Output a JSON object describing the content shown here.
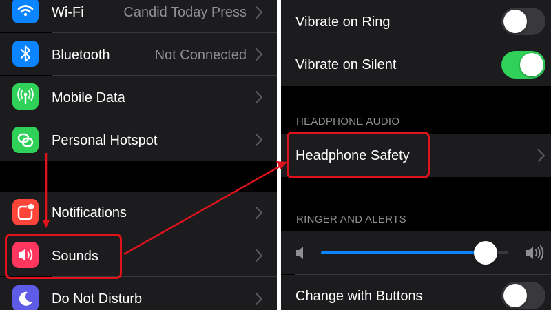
{
  "left_panel": {
    "rows": [
      {
        "label": "Wi-Fi",
        "value": "Candid Today Press",
        "icon": "wifi-icon",
        "icon_color": "#0a84ff"
      },
      {
        "label": "Bluetooth",
        "value": "Not Connected",
        "icon": "bluetooth-icon",
        "icon_color": "#0a84ff"
      },
      {
        "label": "Mobile Data",
        "value": "",
        "icon": "antenna-icon",
        "icon_color": "#30d158"
      },
      {
        "label": "Personal Hotspot",
        "value": "",
        "icon": "hotspot-icon",
        "icon_color": "#30d158"
      },
      {
        "label": "Notifications",
        "value": "",
        "icon": "notifications-icon",
        "icon_color": "#ff453a"
      },
      {
        "label": "Sounds",
        "value": "",
        "icon": "speaker-icon",
        "icon_color": "#ff375f"
      },
      {
        "label": "Do Not Disturb",
        "value": "",
        "icon": "moon-icon",
        "icon_color": "#5e5ce6"
      }
    ]
  },
  "right_panel": {
    "vibrate_on_ring": {
      "label": "Vibrate on Ring",
      "state": "off"
    },
    "vibrate_on_silent": {
      "label": "Vibrate on Silent",
      "state": "on"
    },
    "headphone_audio_header": "HEADPHONE AUDIO",
    "headphone_safety": {
      "label": "Headphone Safety"
    },
    "ringer_header": "RINGER AND ALERTS",
    "volume_slider": {
      "level": 0.88,
      "low_icon": "speaker-low-icon",
      "high_icon": "speaker-high-icon"
    },
    "change_with_buttons": {
      "label": "Change with Buttons",
      "state": "off"
    }
  },
  "colors": {
    "annotation": "#e0121c",
    "toggle_on": "#30d158",
    "slider_fill": "#0a84ff"
  }
}
